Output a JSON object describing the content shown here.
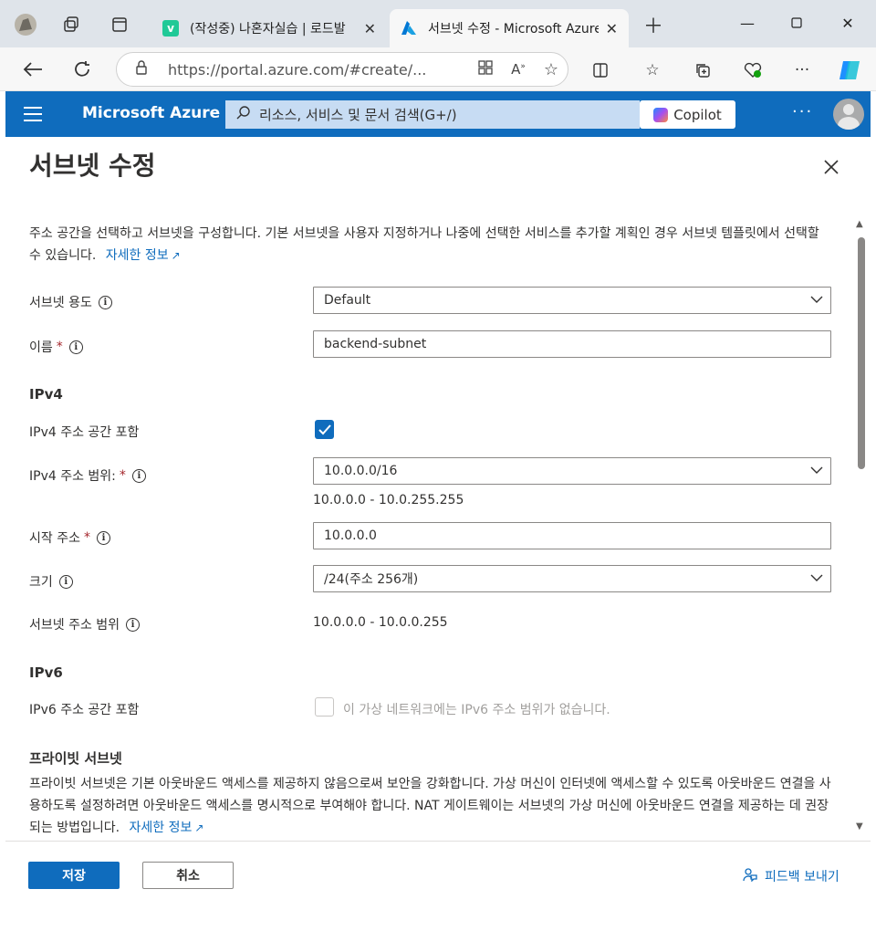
{
  "browser": {
    "tabs": [
      {
        "title": "(작성중) 나혼자실습 | 로드발",
        "favicon_letter": "v",
        "favicon_color": "#20c997",
        "active": false
      },
      {
        "title": "서브넷 수정 - Microsoft Azure",
        "favicon_letter": "A",
        "favicon_color": "#0078d4",
        "active": true
      }
    ],
    "address": "https://portal.azure.com/#create/...",
    "icons": [
      "back-icon",
      "refresh-icon",
      "lock-icon",
      "split-screen-icon",
      "favorites-icon",
      "collections-icon",
      "health-icon",
      "more-icon",
      "copilot-icon"
    ]
  },
  "azure": {
    "brand": "Microsoft Azure",
    "search_placeholder": "리소스, 서비스 및 문서 검색(G+/)",
    "copilot_label": "Copilot",
    "more_label": "···"
  },
  "blade": {
    "title": "서브넷 수정",
    "description": "주소 공간을 선택하고 서브넷을 구성합니다. 기본 서브넷을 사용자 지정하거나 나중에 선택한 서비스를 추가할 계획인 경우 서브넷 템플릿에서 선택할 수 있습니다.",
    "description_link": "자세한 정보",
    "fields": {
      "purpose_label": "서브넷 용도",
      "purpose_value": "Default",
      "name_label": "이름",
      "name_value": "backend-subnet",
      "ipv4_heading": "IPv4",
      "ipv4_include_label": "IPv4 주소 공간 포함",
      "ipv4_include_checked": true,
      "ipv4_range_label": "IPv4 주소 범위:",
      "ipv4_range_value": "10.0.0.0/16",
      "ipv4_range_span": "10.0.0.0 - 10.0.255.255",
      "start_label": "시작 주소",
      "start_value": "10.0.0.0",
      "size_label": "크기",
      "size_value": "/24(주소 256개)",
      "subnet_range_label": "서브넷 주소 범위",
      "subnet_range_value": "10.0.0.0 - 10.0.0.255",
      "ipv6_heading": "IPv6",
      "ipv6_include_label": "IPv6 주소 공간 포함",
      "ipv6_include_checked": false,
      "ipv6_note": "이 가상 네트워크에는 IPv6 주소 범위가 없습니다.",
      "private_heading": "프라이빗 서브넷",
      "private_desc": "프라이빗 서브넷은 기본 아웃바운드 액세스를 제공하지 않음으로써 보안을 강화합니다. 가상 머신이 인터넷에 액세스할 수 있도록 아웃바운드 연결을 사용하도록 설정하려면 아웃바운드 액세스를 명시적으로 부여해야 합니다. NAT 게이트웨이는 서브넷의 가상 머신에 아웃바운드 연결을 제공하는 데 권장되는 방법입니다.",
      "private_link": "자세한 정보"
    },
    "required_mark": "*",
    "footer": {
      "save": "저장",
      "cancel": "취소",
      "feedback": "피드백 보내기"
    }
  }
}
